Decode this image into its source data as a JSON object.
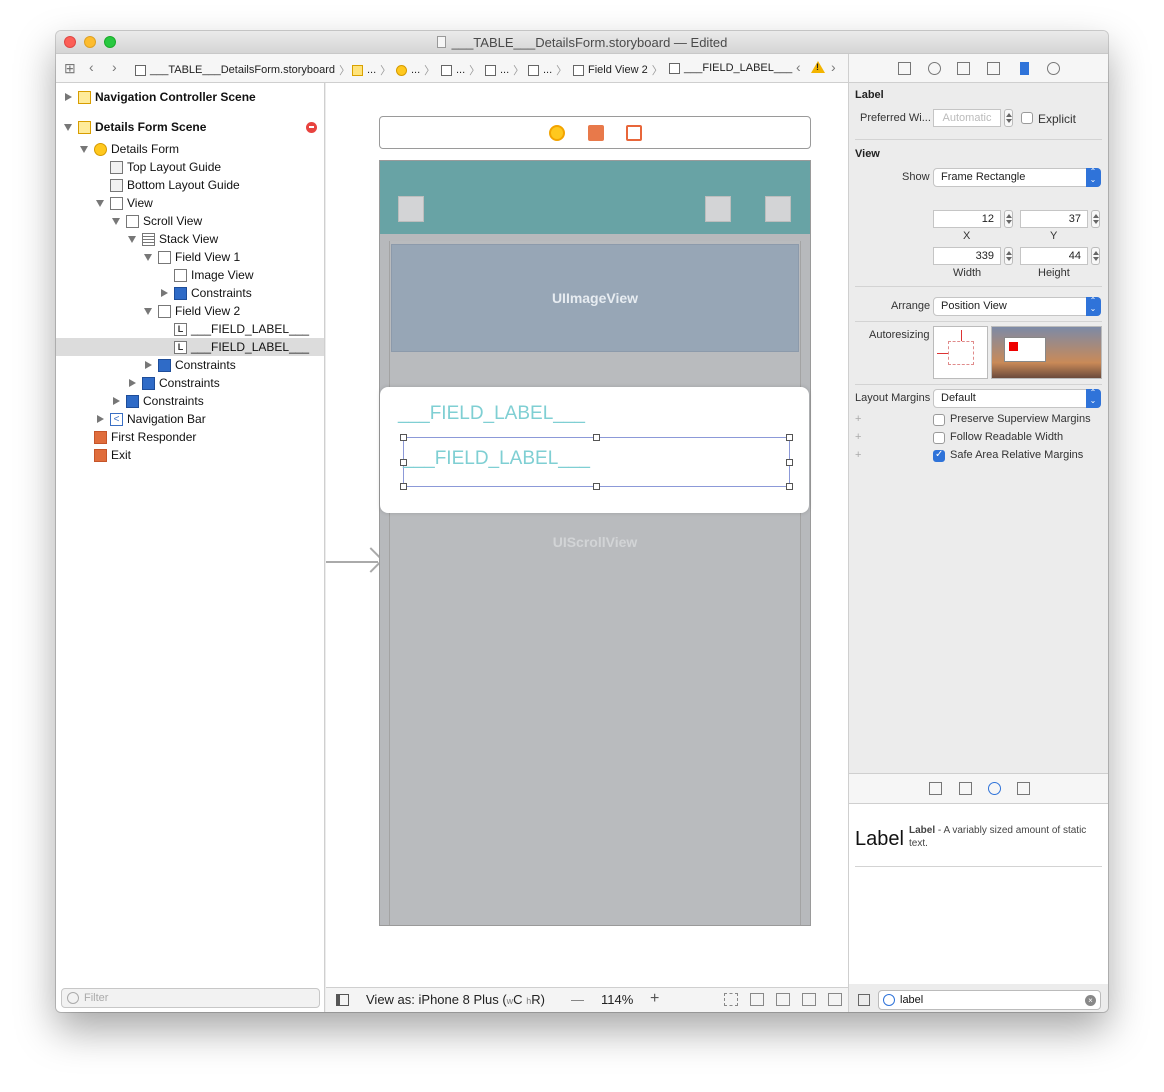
{
  "window": {
    "title": "___TABLE___DetailsForm.storyboard — Edited"
  },
  "jumpbar": {
    "items": [
      {
        "label": "___TABLE___DetailsForm.storyboard"
      },
      {
        "label": "..."
      },
      {
        "label": "..."
      },
      {
        "label": "..."
      },
      {
        "label": "..."
      },
      {
        "label": "..."
      },
      {
        "label": "Field View 2"
      },
      {
        "label": "___FIELD_LABEL___"
      }
    ],
    "warning_glyph": "!"
  },
  "navigator": {
    "rows": [
      {
        "label": "Navigation Controller Scene"
      },
      {
        "label": "Details Form Scene"
      },
      {
        "label": "Details Form"
      },
      {
        "label": "Top Layout Guide"
      },
      {
        "label": "Bottom Layout Guide"
      },
      {
        "label": "View"
      },
      {
        "label": "Scroll View"
      },
      {
        "label": "Stack View"
      },
      {
        "label": "Field View 1"
      },
      {
        "label": "Image View"
      },
      {
        "label": "Constraints"
      },
      {
        "label": "Field View 2"
      },
      {
        "label": "___FIELD_LABEL___"
      },
      {
        "label": "___FIELD_LABEL___"
      },
      {
        "label": "Constraints"
      },
      {
        "label": "Constraints"
      },
      {
        "label": "Constraints"
      },
      {
        "label": "Navigation Bar"
      },
      {
        "label": "First Responder"
      },
      {
        "label": "Exit"
      }
    ],
    "label_icon_glyph": "L",
    "navbar_icon_glyph": "<",
    "filter_placeholder": "Filter"
  },
  "canvas": {
    "imageview_label": "UIImageView",
    "scrollview_label": "UIScrollView",
    "field_label_1": "___FIELD_LABEL___",
    "field_label_2": "___FIELD_LABEL___"
  },
  "canvas_bar": {
    "view_as_prefix": "View as: iPhone 8 Plus (",
    "w_size": "w",
    "w_class": "C",
    "h_size": "h",
    "h_class": "R",
    "view_as_suffix": ")",
    "zoom_minus": "—",
    "zoom_level": "114%",
    "zoom_plus": "+"
  },
  "inspector": {
    "label_section": {
      "title": "Label",
      "preferred_width_label": "Preferred Wi...",
      "preferred_width_value": "Automatic",
      "explicit_label": "Explicit"
    },
    "view_section": {
      "title": "View",
      "show_label": "Show",
      "show_value": "Frame Rectangle",
      "x_value": "12",
      "x_label": "X",
      "y_value": "37",
      "y_label": "Y",
      "width_value": "339",
      "width_label": "Width",
      "height_value": "44",
      "height_label": "Height",
      "arrange_label": "Arrange",
      "arrange_value": "Position View",
      "autoresizing_label": "Autoresizing",
      "layout_margins_label": "Layout Margins",
      "layout_margins_value": "Default",
      "preserve_label": "Preserve Superview Margins",
      "follow_label": "Follow Readable Width",
      "safe_area_label": "Safe Area Relative Margins",
      "plus_glyph": "+"
    },
    "library": {
      "big_label": "Label",
      "title": "Label",
      "description": " - A variably sized amount of static text.",
      "filter_value": "label",
      "clear_glyph": "×"
    }
  }
}
